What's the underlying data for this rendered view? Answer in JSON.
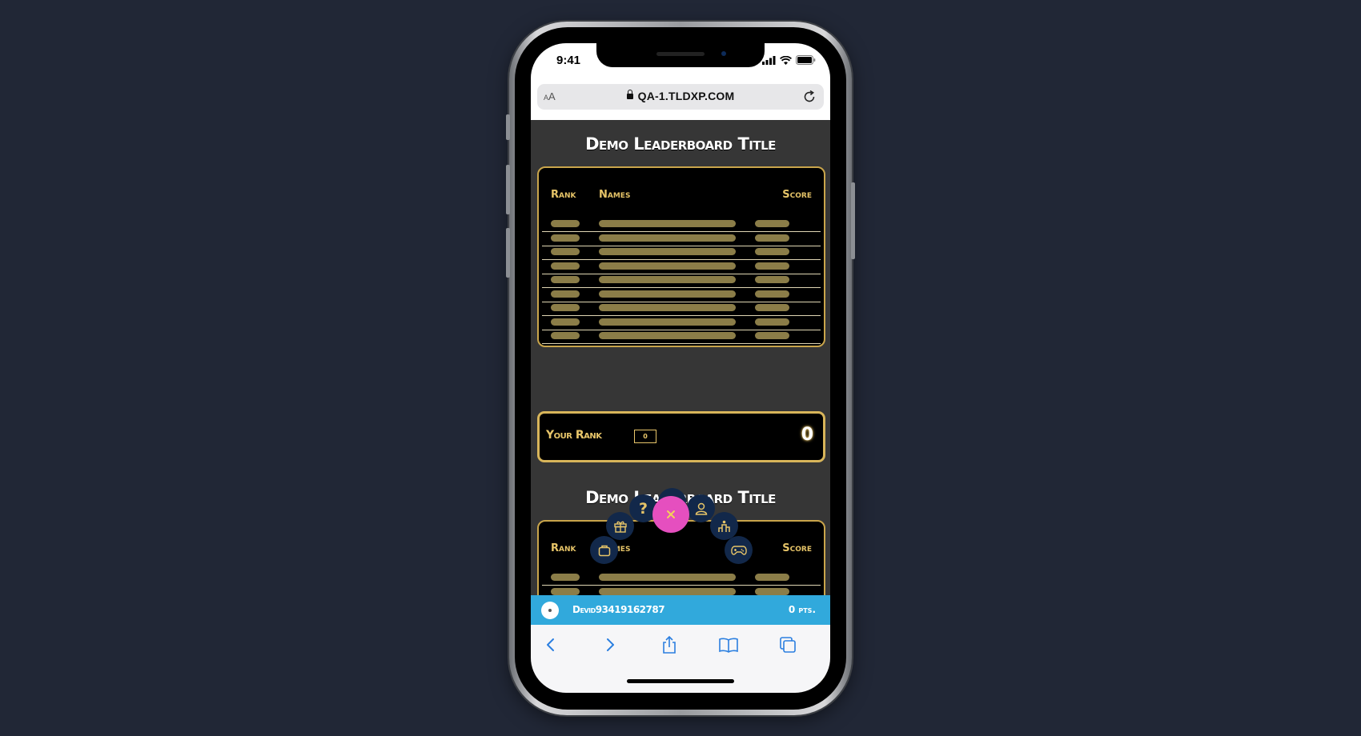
{
  "status_bar": {
    "time": "9:41"
  },
  "browser": {
    "text_size_label_small": "A",
    "text_size_label_large": "A",
    "url": "QA-1.TLDXP.COM"
  },
  "leaderboards": [
    {
      "title": "Demo Leaderboard Title",
      "headers": {
        "rank": "Rank",
        "names": "Names",
        "score": "Score"
      },
      "placeholder_rows": 10
    },
    {
      "title": "Demo Leaderboard Title",
      "headers": {
        "rank": "Rank",
        "names": "Names",
        "score": "Score"
      },
      "placeholder_rows": 4
    }
  ],
  "your_rank": {
    "label": "Your Rank",
    "rank": "0",
    "score": "0"
  },
  "fab_menu": {
    "items": [
      "bag-icon",
      "gift-icon",
      "help-icon",
      "bag-icon",
      "user-icon",
      "leaderboard-icon",
      "gamepad-icon"
    ],
    "close": "close-icon",
    "colors": {
      "item_bg": "#12284a",
      "icon": "#e6c468",
      "close_bg": "#e54fbf",
      "close_x": "#f3d15a"
    }
  },
  "user_bar": {
    "username": "Devid93419162787",
    "points": "0 pts."
  },
  "safari_toolbar": {
    "items": [
      "back-icon",
      "forward-icon",
      "share-icon",
      "bookmarks-icon",
      "tabs-icon"
    ]
  },
  "colors": {
    "background": "#212736",
    "gold": "#c9a54b",
    "user_bar": "#31a9dc",
    "page_bg": "#363636"
  }
}
